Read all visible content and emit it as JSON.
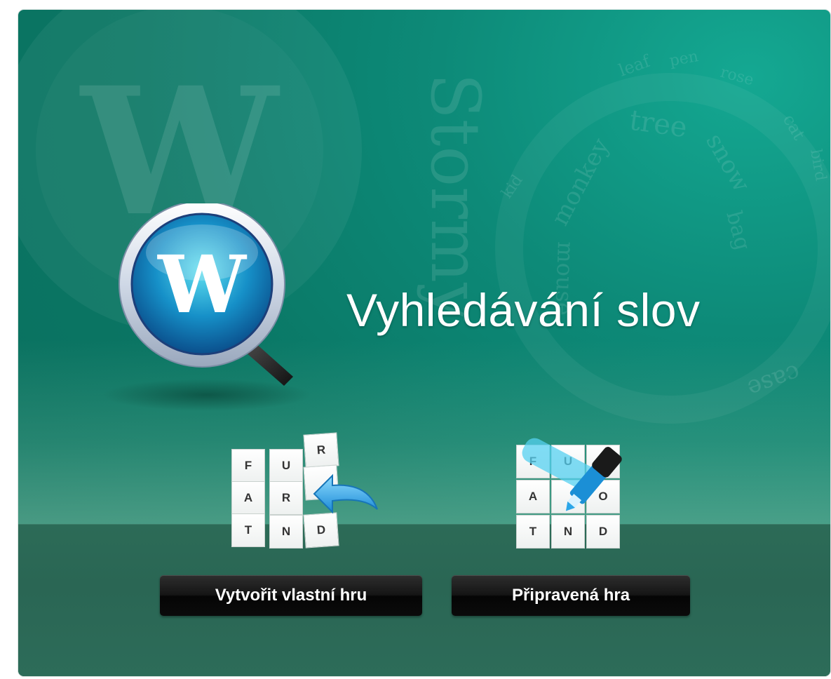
{
  "title": "Vyhledávání slov",
  "background_words": [
    "Stormy",
    "tree",
    "snow",
    "monkey",
    "mouse",
    "bag",
    "case",
    "cat",
    "bird",
    "pen",
    "rose",
    "kid",
    "leaf"
  ],
  "logo": {
    "letter": "W",
    "icon": "magnifier-w-icon"
  },
  "modes": [
    {
      "label": "Vytvořit vlastní hru",
      "icon": "tiles-with-arrow-icon",
      "tiles": [
        "F",
        "U",
        "R",
        "A",
        "R",
        "T",
        "N",
        "D"
      ]
    },
    {
      "label": "Připravená hra",
      "icon": "tiles-with-marker-icon",
      "tiles": [
        "F",
        "U",
        "A",
        "O",
        "T",
        "N",
        "D"
      ]
    }
  ],
  "colors": {
    "panel": "#0b7a67",
    "accent": "#14a892",
    "button": "#111111"
  }
}
